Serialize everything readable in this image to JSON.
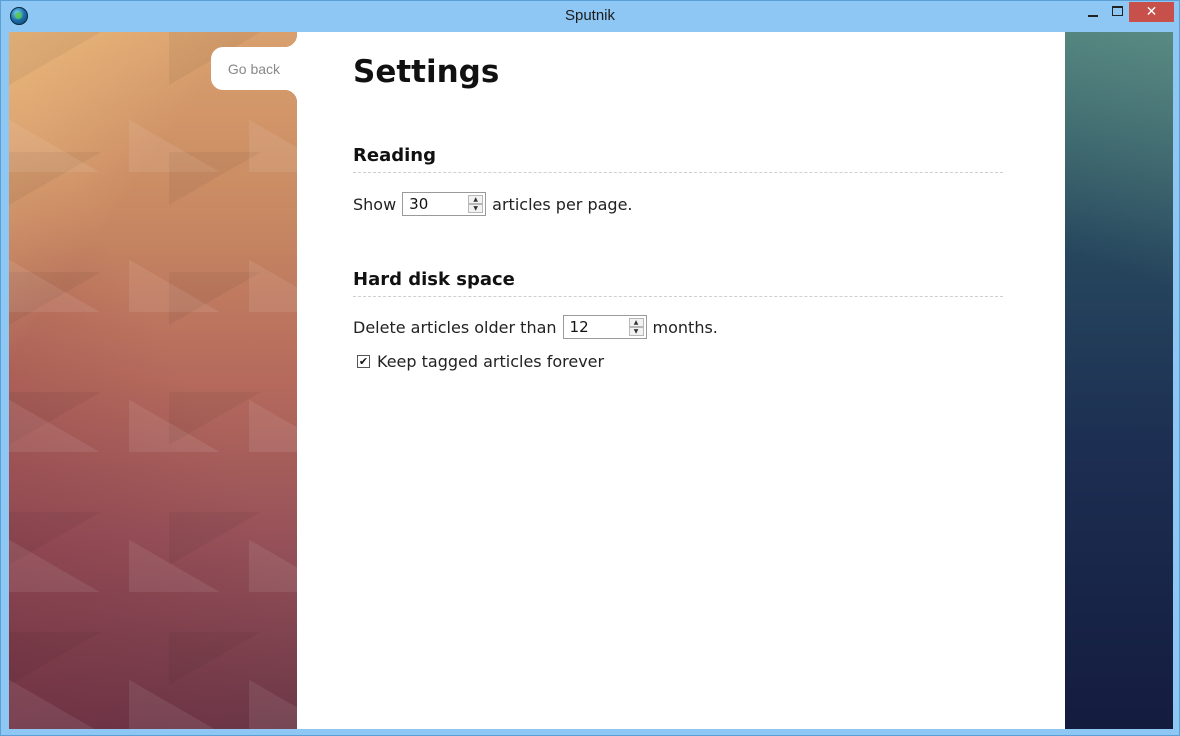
{
  "window": {
    "title": "Sputnik",
    "close_glyph": "✕"
  },
  "nav": {
    "go_back_label": "Go back"
  },
  "settings": {
    "title": "Settings",
    "reading": {
      "heading": "Reading",
      "show_prefix": "Show",
      "articles_per_page": "30",
      "show_suffix": "articles per page."
    },
    "disk": {
      "heading": "Hard disk space",
      "delete_prefix": "Delete articles older than",
      "months": "12",
      "delete_suffix": "months.",
      "keep_tagged_label": "Keep tagged articles forever",
      "keep_tagged_checked": true,
      "check_glyph": "✔"
    }
  },
  "spinner": {
    "up_glyph": "▲",
    "down_glyph": "▼"
  },
  "colors": {
    "close_button": "#c7504a",
    "titlebar": "#8ec6f4"
  }
}
